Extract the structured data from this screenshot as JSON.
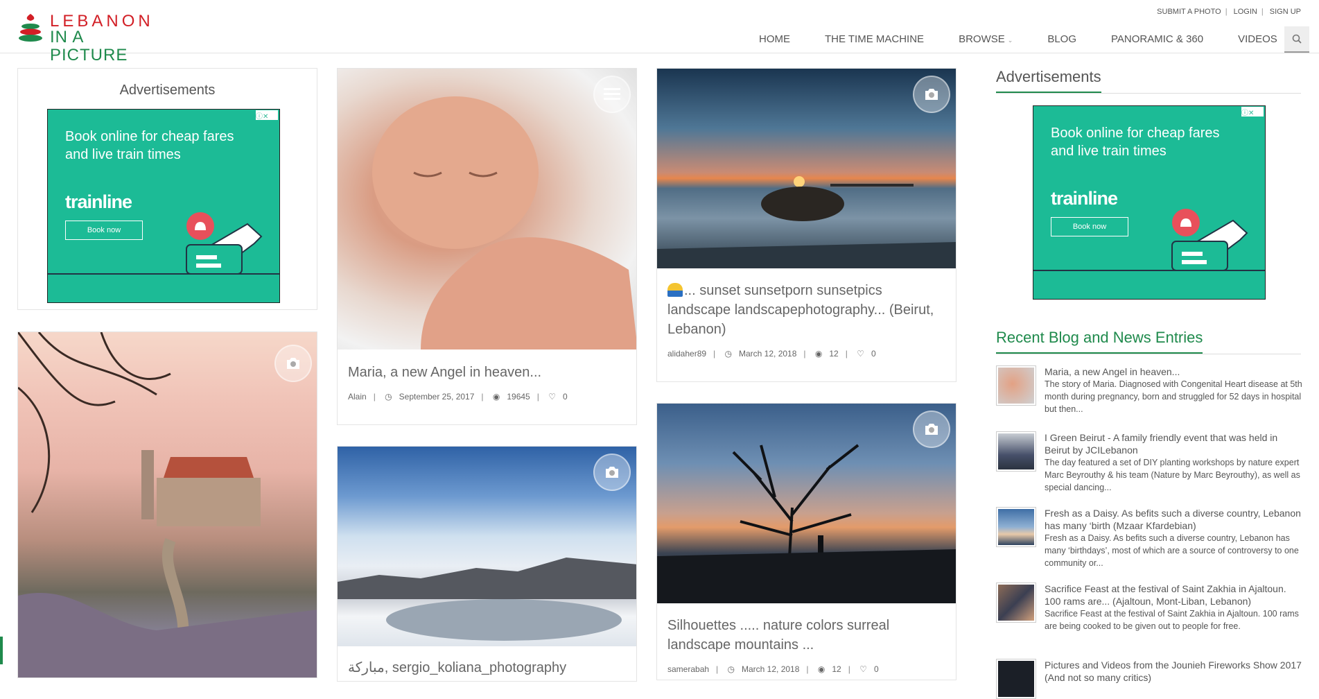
{
  "header": {
    "logo_line1": "LEBANON",
    "logo_line2": "IN A PICTURE",
    "top_links": [
      "SUBMIT A PHOTO",
      "LOGIN",
      "SIGN UP"
    ],
    "nav": [
      "HOME",
      "THE TIME MACHINE",
      "BROWSE",
      "BLOG",
      "PANORAMIC & 360",
      "VIDEOS"
    ],
    "search_icon": "search-icon"
  },
  "ads": {
    "heading": "Advertisements",
    "ad_text": "Book online for cheap fares and live train times",
    "ad_brand": "trainline",
    "ad_button": "Book now",
    "ad_choice": "ⓘ✕"
  },
  "cards": [
    {
      "title": "Maria, a new Angel in heaven...",
      "author": "Alain",
      "date": "September 25, 2017",
      "views": "19645",
      "likes": "0",
      "icon": "list-icon"
    },
    {
      "title": "... sunset sunsetporn sunsetpics landscape landscapephotography... (Beirut, Lebanon)",
      "author": "alidaher89",
      "date": "March 12, 2018",
      "views": "12",
      "likes": "0",
      "icon": "camera-icon"
    },
    {
      "title": "Silhouettes ..... nature colors surreal landscape mountains ...",
      "author": "samerabah",
      "date": "March 12, 2018",
      "views": "12",
      "likes": "0",
      "icon": "camera-icon"
    },
    {
      "title": "مباركة, sergio_koliana_photography",
      "icon": "camera-icon"
    },
    {
      "icon": "camera-icon"
    }
  ],
  "sidebar": {
    "ads_heading": "Advertisements",
    "blog_heading": "Recent Blog and News Entries",
    "entries": [
      {
        "title": "Maria, a new Angel in heaven...",
        "desc": "The story of Maria. Diagnosed with Congenital Heart disease at 5th month during pregnancy, born and struggled for 52 days in hospital but then..."
      },
      {
        "title": "I Green Beirut - A family friendly event that was held in Beirut by JCILebanon",
        "desc": "The day featured a set of DIY planting workshops by nature expert Marc Beyrouthy & his team (Nature by Marc Beyrouthy), as well as special dancing..."
      },
      {
        "title": "Fresh as a Daisy. As befits such a diverse country, Lebanon has many ‘birth (Mzaar Kfardebian)",
        "desc": "Fresh as a Daisy. As befits such a diverse country, Lebanon has many ‘birthdays’, most of which are a source of controversy to one community or..."
      },
      {
        "title": "Sacrifice Feast at the festival of Saint Zakhia in Ajaltoun. 100 rams are... (Ajaltoun, Mont-Liban, Lebanon)",
        "desc": "Sacrifice Feast at the festival of Saint Zakhia in Ajaltoun. 100 rams are being cooked to be given out to people for free."
      },
      {
        "title": "Pictures and Videos from the Jounieh Fireworks Show 2017 (And not so many critics)",
        "desc": ""
      }
    ]
  }
}
